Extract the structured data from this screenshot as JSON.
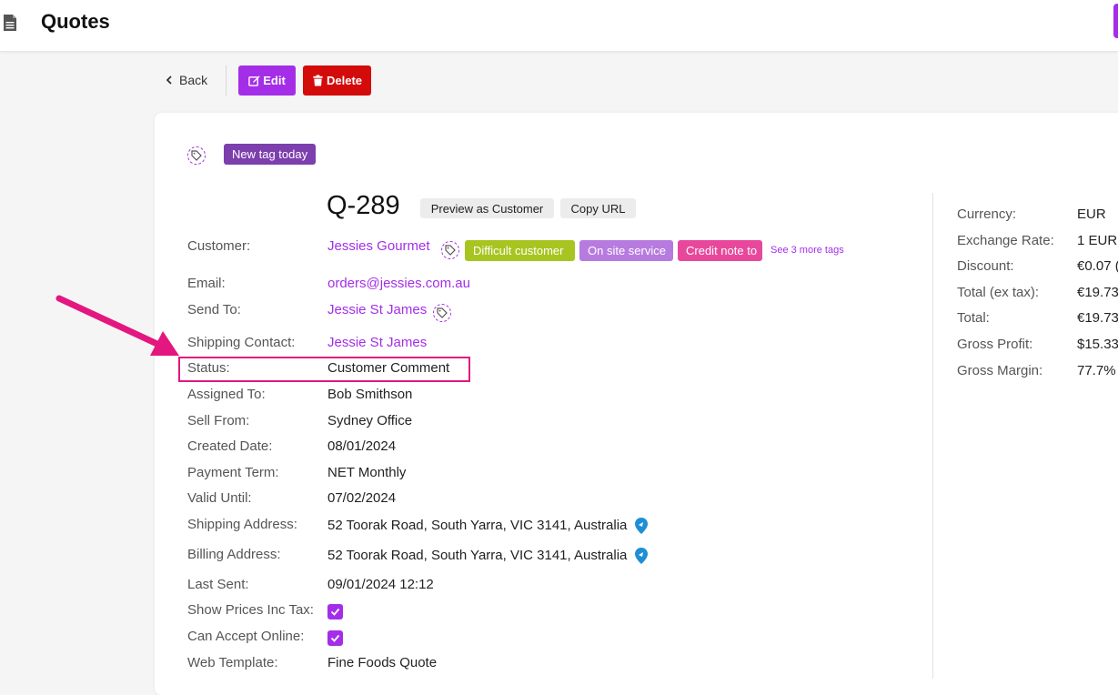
{
  "header": {
    "title": "Quotes",
    "doc_icon": "document-icon"
  },
  "toolbar": {
    "back_label": "Back",
    "edit_label": "Edit",
    "delete_label": "Delete"
  },
  "tags": {
    "top_tag": "New tag today"
  },
  "quote": {
    "number": "Q-289",
    "preview_label": "Preview as Customer",
    "copy_url_label": "Copy URL"
  },
  "customer_tags": {
    "items": [
      {
        "label": "Difficult customer",
        "color": "#a7c520"
      },
      {
        "label": "On site service",
        "color": "#b77be0"
      },
      {
        "label": "Credit note to",
        "color": "#e8489b"
      }
    ],
    "see_more": "See 3 more tags"
  },
  "colors": {
    "accent": "#a42ee8",
    "delete": "#d40b0b",
    "highlight": "#e3177f",
    "map_pin": "#1e8fd6"
  },
  "fields": {
    "customer": {
      "label": "Customer:",
      "value": "Jessies Gourmet"
    },
    "email": {
      "label": "Email:",
      "value": "orders@jessies.com.au"
    },
    "send_to": {
      "label": "Send To:",
      "value": "Jessie St James"
    },
    "shipping_contact": {
      "label": "Shipping Contact:",
      "value": "Jessie St James"
    },
    "status": {
      "label": "Status:",
      "value": "Customer Comment"
    },
    "assigned_to": {
      "label": "Assigned To:",
      "value": "Bob Smithson"
    },
    "sell_from": {
      "label": "Sell From:",
      "value": "Sydney Office"
    },
    "created_date": {
      "label": "Created Date:",
      "value": "08/01/2024"
    },
    "payment_term": {
      "label": "Payment Term:",
      "value": "NET Monthly"
    },
    "valid_until": {
      "label": "Valid Until:",
      "value": "07/02/2024"
    },
    "shipping_address": {
      "label": "Shipping Address:",
      "value": "52 Toorak Road, South Yarra, VIC 3141, Australia"
    },
    "billing_address": {
      "label": "Billing Address:",
      "value": "52 Toorak Road, South Yarra, VIC 3141, Australia"
    },
    "last_sent": {
      "label": "Last Sent:",
      "value": "09/01/2024 12:12"
    },
    "show_prices_inc_tax": {
      "label": "Show Prices Inc Tax:",
      "checked": true
    },
    "can_accept_online": {
      "label": "Can Accept Online:",
      "checked": true
    },
    "web_template": {
      "label": "Web Template:",
      "value": "Fine Foods Quote"
    }
  },
  "summary": {
    "currency": {
      "label": "Currency:",
      "value": "EUR"
    },
    "exchange_rate": {
      "label": "Exchange Rate:",
      "value": "1 EUR"
    },
    "discount": {
      "label": "Discount:",
      "value": "€0.07 ("
    },
    "total_ex_tax": {
      "label": "Total (ex tax):",
      "value": "€19.73"
    },
    "total": {
      "label": "Total:",
      "value": "€19.73"
    },
    "gross_profit": {
      "label": "Gross Profit:",
      "value": "$15.33"
    },
    "gross_margin": {
      "label": "Gross Margin:",
      "value": "77.7%"
    }
  }
}
